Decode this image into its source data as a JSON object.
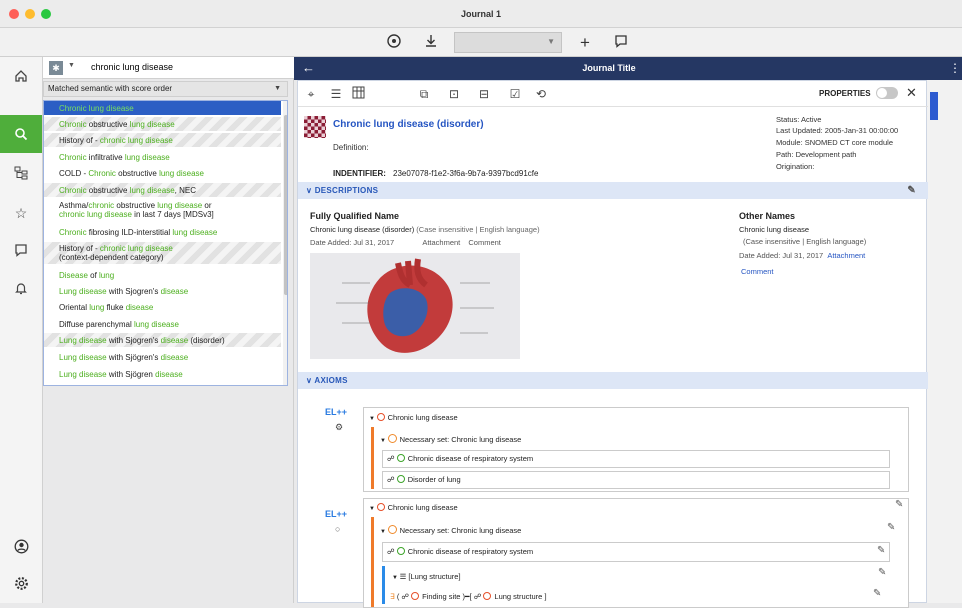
{
  "window": {
    "title": "Journal 1"
  },
  "toolbar": {
    "icons": [
      "target-icon",
      "download-icon",
      "add-icon",
      "comment-icon"
    ],
    "select_value": ""
  },
  "rail": {
    "items": [
      "home-icon",
      "search-icon",
      "taxonomy-icon",
      "star-icon",
      "chat-icon",
      "bell-icon",
      "account-icon",
      "settings-icon"
    ]
  },
  "search": {
    "query": "chronic lung disease",
    "sort_label": "Matched semantic with score order",
    "results": [
      {
        "parts": [
          [
            "Chronic lung disease",
            "g"
          ]
        ]
      },
      {
        "parts": [
          [
            "Chronic",
            "g"
          ],
          [
            " obstructive ",
            ""
          ],
          [
            "lung disease",
            "g"
          ]
        ]
      },
      {
        "parts": [
          [
            "History of - ",
            ""
          ],
          [
            "chronic lung disease",
            "g"
          ]
        ]
      },
      {
        "parts": [
          [
            "Chronic",
            "g"
          ],
          [
            " infiltrative ",
            ""
          ],
          [
            "lung disease",
            "g"
          ]
        ]
      },
      {
        "parts": [
          [
            "COLD - ",
            ""
          ],
          [
            "Chronic",
            "g"
          ],
          [
            " obstructive ",
            ""
          ],
          [
            "lung disease",
            "g"
          ]
        ]
      },
      {
        "parts": [
          [
            "Chronic",
            "g"
          ],
          [
            " obstructive ",
            ""
          ],
          [
            "lung disease",
            "g"
          ],
          [
            ", NEC",
            ""
          ]
        ]
      },
      {
        "parts": [
          [
            "Asthma/",
            ""
          ],
          [
            "chronic",
            "g"
          ],
          [
            " obstructive ",
            ""
          ],
          [
            "lung disease",
            "g"
          ],
          [
            " or",
            ""
          ]
        ],
        "line2": [
          [
            "chronic lung disease",
            "g"
          ],
          [
            " in last 7 days [MDSv3]",
            ""
          ]
        ]
      },
      {
        "parts": [
          [
            "Chronic",
            "g"
          ],
          [
            " fibrosing ILD-interstitial ",
            ""
          ],
          [
            "lung disease",
            "g"
          ]
        ]
      },
      {
        "parts": [
          [
            "History of - ",
            ""
          ],
          [
            "chronic lung disease",
            "g"
          ]
        ],
        "line2": [
          [
            "(context-dependent category)",
            ""
          ]
        ]
      },
      {
        "parts": [
          [
            "Disease",
            "g"
          ],
          [
            " of ",
            ""
          ],
          [
            "lung",
            "g"
          ]
        ]
      },
      {
        "parts": [
          [
            "Lung disease",
            "g"
          ],
          [
            " with Sjogren's ",
            ""
          ],
          [
            "disease",
            "g"
          ]
        ]
      },
      {
        "parts": [
          [
            "Oriental ",
            ""
          ],
          [
            "lung",
            "g"
          ],
          [
            " fluke ",
            ""
          ],
          [
            "disease",
            "g"
          ]
        ]
      },
      {
        "parts": [
          [
            "Diffuse parenchymal ",
            ""
          ],
          [
            "lung disease",
            "g"
          ]
        ]
      },
      {
        "parts": [
          [
            "Lung disease",
            "g"
          ],
          [
            " with Sjogren's ",
            ""
          ],
          [
            "disease",
            "g"
          ],
          [
            " (disorder)",
            ""
          ]
        ]
      },
      {
        "parts": [
          [
            "Lung disease",
            "g"
          ],
          [
            " with Sjögren's ",
            ""
          ],
          [
            "disease",
            "g"
          ]
        ]
      },
      {
        "parts": [
          [
            "Lung disease",
            "g"
          ],
          [
            " with Sjögren ",
            ""
          ],
          [
            "disease",
            "g"
          ]
        ]
      }
    ]
  },
  "journal": {
    "title": "Journal Title"
  },
  "detail": {
    "properties_label": "PROPERTIES",
    "concept_title": "Chronic lung disease (disorder)",
    "definition_label": "Definition:",
    "identifier_label": "INDENTIFIER:",
    "identifier_value": "23e07078-f1e2-3f6a-9b7a-9397bcd91cfe",
    "meta": {
      "status": "Status: Active",
      "last_updated": "Last Updated: 2005-Jan-31 00:00:00",
      "module": "Module: SNOMED CT core module",
      "path": "Path: Development path",
      "origination": "Origination:"
    },
    "descriptions_header": "DESCRIPTIONS",
    "fqn": {
      "label": "Fully Qualified Name",
      "value": "Chronic lung disease (disorder)",
      "value_note": " (Case insensitive | English language)",
      "date": "Date Added:  Jul 31, 2017",
      "attachment": "Attachment",
      "comment": "Comment"
    },
    "other_names": {
      "label": "Other Names",
      "value": "Chronic lung disease",
      "note": "(Case insensitive | English language)",
      "date": "Date Added: Jul 31, 2017",
      "attachment": "Attachment",
      "comment": "Comment"
    },
    "axioms_header": "AXIOMS",
    "axiom1": {
      "badge": "EL++",
      "root": "Chronic lung disease",
      "necessary": "Necessary set: Chronic lung disease",
      "rows": [
        "Chronic disease of respiratory system",
        "Disorder of lung"
      ]
    },
    "axiom2": {
      "badge": "EL++",
      "root": "Chronic lung disease",
      "necessary": "Necessary set: Chronic lung disease",
      "rows": [
        "Chronic disease of respiratory system"
      ],
      "group": "[Lung structure]",
      "role": "Finding site",
      "role_value": "Lung structure"
    }
  },
  "colors": {
    "accent_green": "#4fae3b",
    "journal_bar": "#253763",
    "selection": "#2b5ec4",
    "link": "#2555c2",
    "axiom_orange": "#ef7a2a"
  }
}
